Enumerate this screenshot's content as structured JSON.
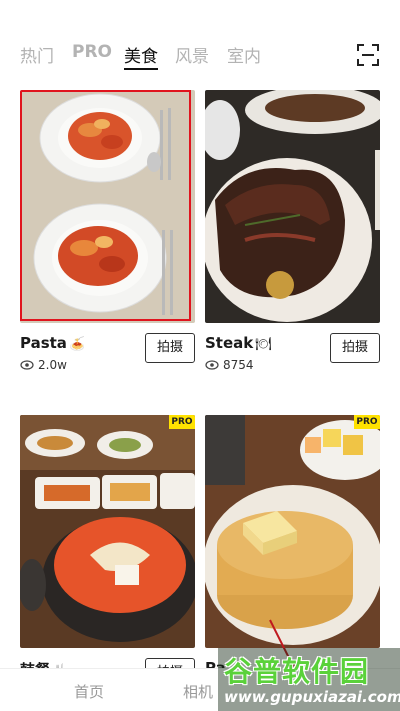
{
  "tabs": [
    {
      "label": "热门",
      "active": false
    },
    {
      "label": "PRO",
      "active": false
    },
    {
      "label": "美食",
      "active": true
    },
    {
      "label": "风景",
      "active": false
    },
    {
      "label": "室内",
      "active": false
    }
  ],
  "scan_icon": "scan-frame-icon",
  "cards": [
    {
      "title": "Pasta",
      "emoji": "🍝",
      "views": "2.0w",
      "button": "拍摄",
      "pro": false,
      "selected": true,
      "photo": "pasta"
    },
    {
      "title": "Steak",
      "emoji": "🍽",
      "views": "8754",
      "button": "拍摄",
      "pro": false,
      "selected": false,
      "photo": "steak"
    },
    {
      "title": "韩餐",
      "emoji": "🍴",
      "views": "",
      "button": "拍摄",
      "pro": true,
      "pro_label": "PRO",
      "selected": false,
      "photo": "korean-stew"
    },
    {
      "title": "Pa",
      "emoji": "",
      "views": "",
      "button": "",
      "pro": true,
      "pro_label": "PRO",
      "selected": false,
      "photo": "pancake"
    }
  ],
  "bottom_nav": [
    {
      "label": "首页"
    },
    {
      "label": "相机"
    }
  ],
  "watermark": {
    "line1": "谷普软件园",
    "line2": "www.gupuxiazai.com"
  },
  "colors": {
    "active_tab": "#111111",
    "inactive_tab": "#b3b3b3",
    "selection": "#e0141e",
    "pro_badge": "#ffe200",
    "watermark_green": "#5ad13a"
  }
}
